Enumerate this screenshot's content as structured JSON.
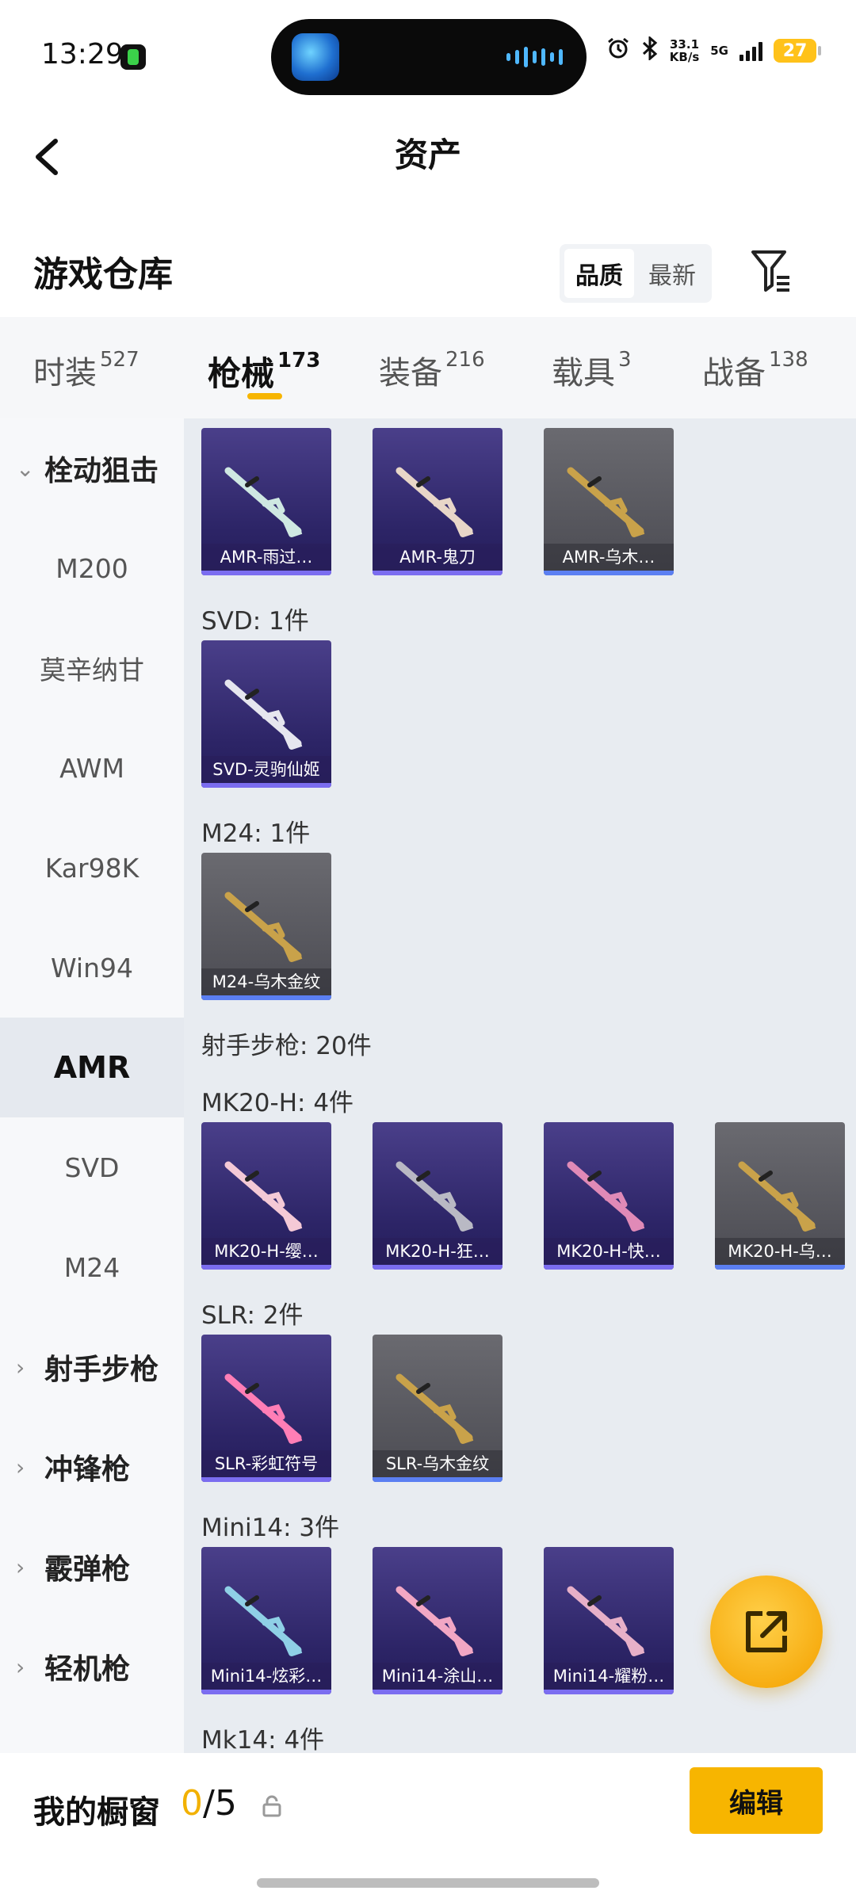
{
  "status": {
    "time": "13:29",
    "net_speed": "33.1",
    "net_unit": "KB/s",
    "net_type": "5G",
    "battery": "27"
  },
  "nav": {
    "title": "资产"
  },
  "warehouse": {
    "title": "游戏仓库",
    "sort_options": [
      "品质",
      "最新"
    ],
    "sort_selected": "品质"
  },
  "tabs": [
    {
      "label": "时装",
      "count": "527"
    },
    {
      "label": "枪械",
      "count": "173",
      "active": true
    },
    {
      "label": "装备",
      "count": "216"
    },
    {
      "label": "载具",
      "count": "3"
    },
    {
      "label": "战备",
      "count": "138"
    }
  ],
  "sidebar": {
    "items": [
      {
        "label": "栓动狙击",
        "type": "group",
        "expanded": true
      },
      {
        "label": "M200"
      },
      {
        "label": "莫辛纳甘"
      },
      {
        "label": "AWM"
      },
      {
        "label": "Kar98K"
      },
      {
        "label": "Win94"
      },
      {
        "label": "AMR",
        "selected": true
      },
      {
        "label": "SVD"
      },
      {
        "label": "M24"
      },
      {
        "label": "射手步枪",
        "type": "group"
      },
      {
        "label": "冲锋枪",
        "type": "group"
      },
      {
        "label": "霰弹枪",
        "type": "group"
      },
      {
        "label": "轻机枪",
        "type": "group"
      }
    ]
  },
  "content": {
    "groups": [
      {
        "label": "",
        "items": [
          {
            "name": "AMR-雨过…",
            "style": "purple",
            "gun_color": "#cfe8e2"
          },
          {
            "name": "AMR-鬼刀",
            "style": "purple",
            "gun_color": "#e8d6c8"
          },
          {
            "name": "AMR-乌木…",
            "style": "grey",
            "gun_color": "#c9a24a"
          }
        ]
      },
      {
        "label": "SVD: 1件",
        "items": [
          {
            "name": "SVD-灵驹仙姬",
            "style": "purple",
            "gun_color": "#e6e6ef"
          }
        ]
      },
      {
        "label": "M24: 1件",
        "items": [
          {
            "name": "M24-乌木金纹",
            "style": "grey",
            "gun_color": "#c9a24a"
          }
        ]
      },
      {
        "label": "射手步枪: 20件",
        "items": []
      },
      {
        "label": "MK20-H: 4件",
        "items": [
          {
            "name": "MK20-H-缨…",
            "style": "purple",
            "gun_color": "#f4c9d6"
          },
          {
            "name": "MK20-H-狂…",
            "style": "purple",
            "gun_color": "#b9b9c4"
          },
          {
            "name": "MK20-H-快…",
            "style": "purple",
            "gun_color": "#e08ab7"
          },
          {
            "name": "MK20-H-乌…",
            "style": "grey",
            "gun_color": "#c9a24a"
          }
        ]
      },
      {
        "label": "SLR: 2件",
        "items": [
          {
            "name": "SLR-彩虹符号",
            "style": "purple",
            "gun_color": "#ff7eb6"
          },
          {
            "name": "SLR-乌木金纹",
            "style": "grey",
            "gun_color": "#c9a24a"
          }
        ]
      },
      {
        "label": "Mini14: 3件",
        "items": [
          {
            "name": "Mini14-炫彩…",
            "style": "purple",
            "gun_color": "#8fd0e6"
          },
          {
            "name": "Mini14-涂山…",
            "style": "purple",
            "gun_color": "#f2a7c4"
          },
          {
            "name": "Mini14-耀粉…",
            "style": "purple",
            "gun_color": "#e7b0c8"
          }
        ]
      },
      {
        "label": "Mk14: 4件",
        "items": []
      }
    ]
  },
  "bottom": {
    "title": "我的橱窗",
    "current": "0",
    "total": "/5",
    "edit_label": "编辑"
  },
  "colors": {
    "accent": "#f7b500",
    "purple_card": "#2c2466",
    "grey_card": "#55555c"
  }
}
